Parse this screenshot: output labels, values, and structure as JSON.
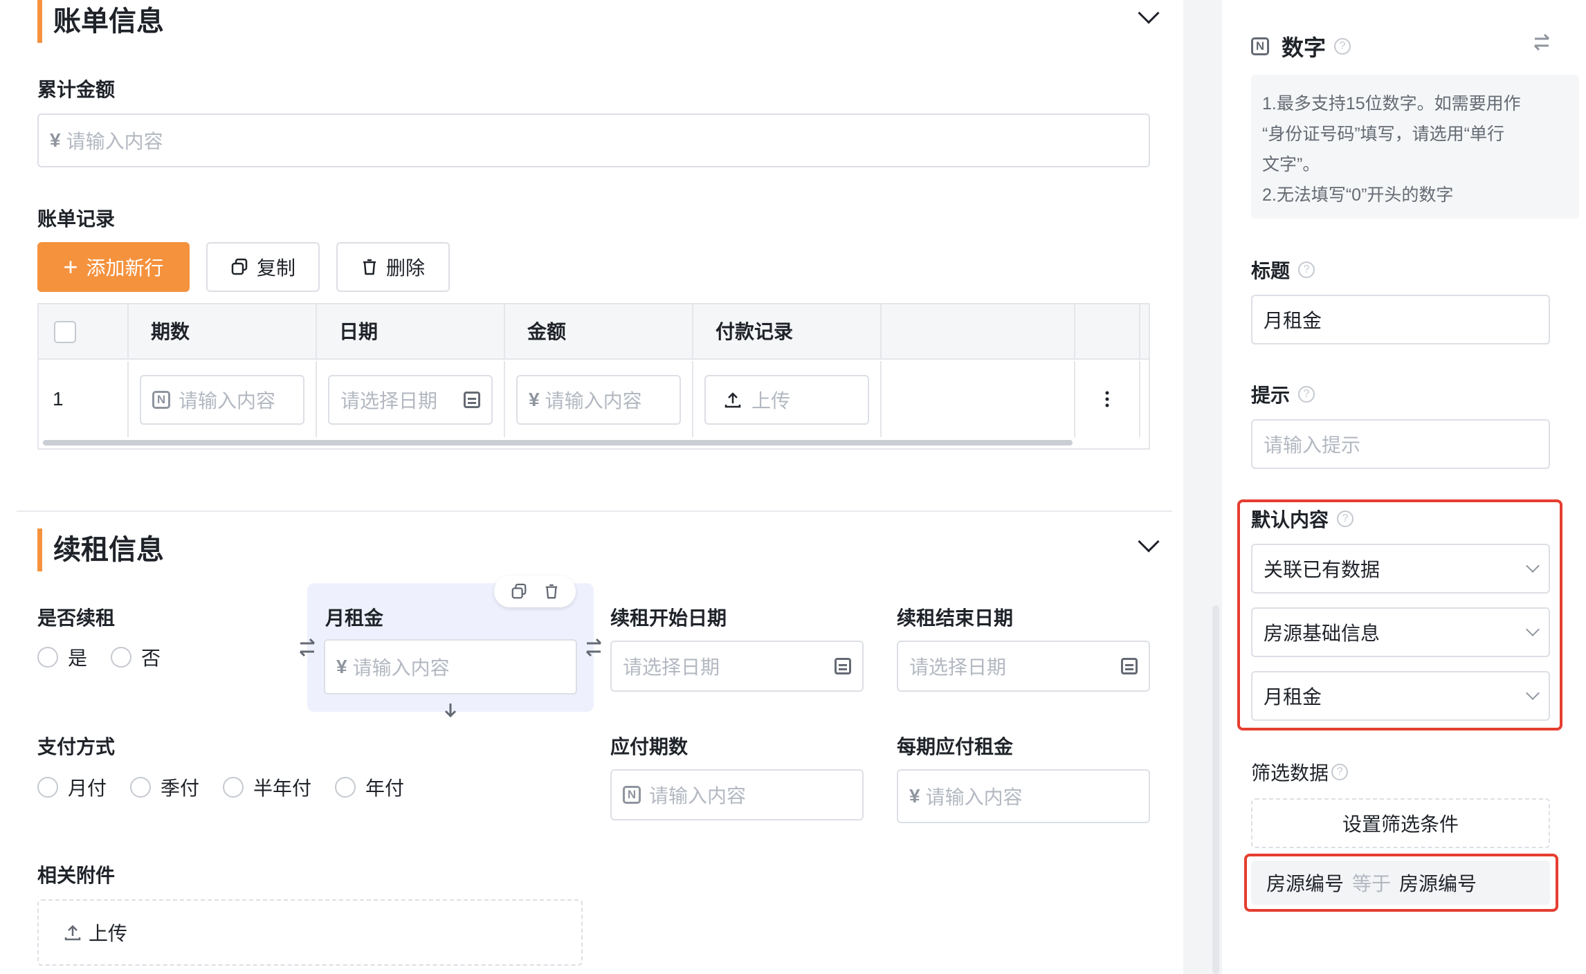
{
  "billing": {
    "title": "账单信息",
    "total_label": "累计金额",
    "total_currency": "¥",
    "total_placeholder": "请输入内容",
    "records_label": "账单记录",
    "add_row": "添加新行",
    "copy": "复制",
    "delete": "删除",
    "columns": [
      "期数",
      "日期",
      "金额",
      "付款记录"
    ],
    "row": {
      "index": "1",
      "period_placeholder": "请输入内容",
      "date_placeholder": "请选择日期",
      "amount_currency": "¥",
      "amount_placeholder": "请输入内容",
      "upload": "上传"
    }
  },
  "renewal": {
    "title": "续租信息",
    "renew_label": "是否续租",
    "renew_options": [
      "是",
      "否"
    ],
    "rent_label": "月租金",
    "rent_currency": "¥",
    "rent_placeholder": "请输入内容",
    "start_label": "续租开始日期",
    "start_placeholder": "请选择日期",
    "end_label": "续租结束日期",
    "end_placeholder": "请选择日期",
    "payment_label": "支付方式",
    "payment_options": [
      "月付",
      "季付",
      "半年付",
      "年付"
    ],
    "periods_label": "应付期数",
    "periods_placeholder": "请输入内容",
    "per_rent_label": "每期应付租金",
    "per_rent_currency": "¥",
    "per_rent_placeholder": "请输入内容",
    "attach_label": "相关附件",
    "attach_upload": "上传"
  },
  "panel": {
    "type_icon": "N",
    "type_label": "数字",
    "note_lines": [
      "1.最多支持15位数字。如需要用作",
      "“身份证号码”填写，请选用“单行",
      "文字”。",
      "2.无法填写“0”开头的数字"
    ],
    "title_label": "标题",
    "title_value": "月租金",
    "hint_label": "提示",
    "hint_placeholder": "请输入提示",
    "default_label": "默认内容",
    "default_mode": "关联已有数据",
    "default_source": "房源基础信息",
    "default_field": "月租金",
    "filter_label": "筛选数据",
    "filter_button": "设置筛选条件",
    "filter_rule": {
      "left": "房源编号",
      "op": "等于",
      "right": "房源编号"
    }
  },
  "colors": {
    "accent": "#f5923e",
    "highlight": "#e53e30",
    "selected_bg": "#eef1fd"
  }
}
